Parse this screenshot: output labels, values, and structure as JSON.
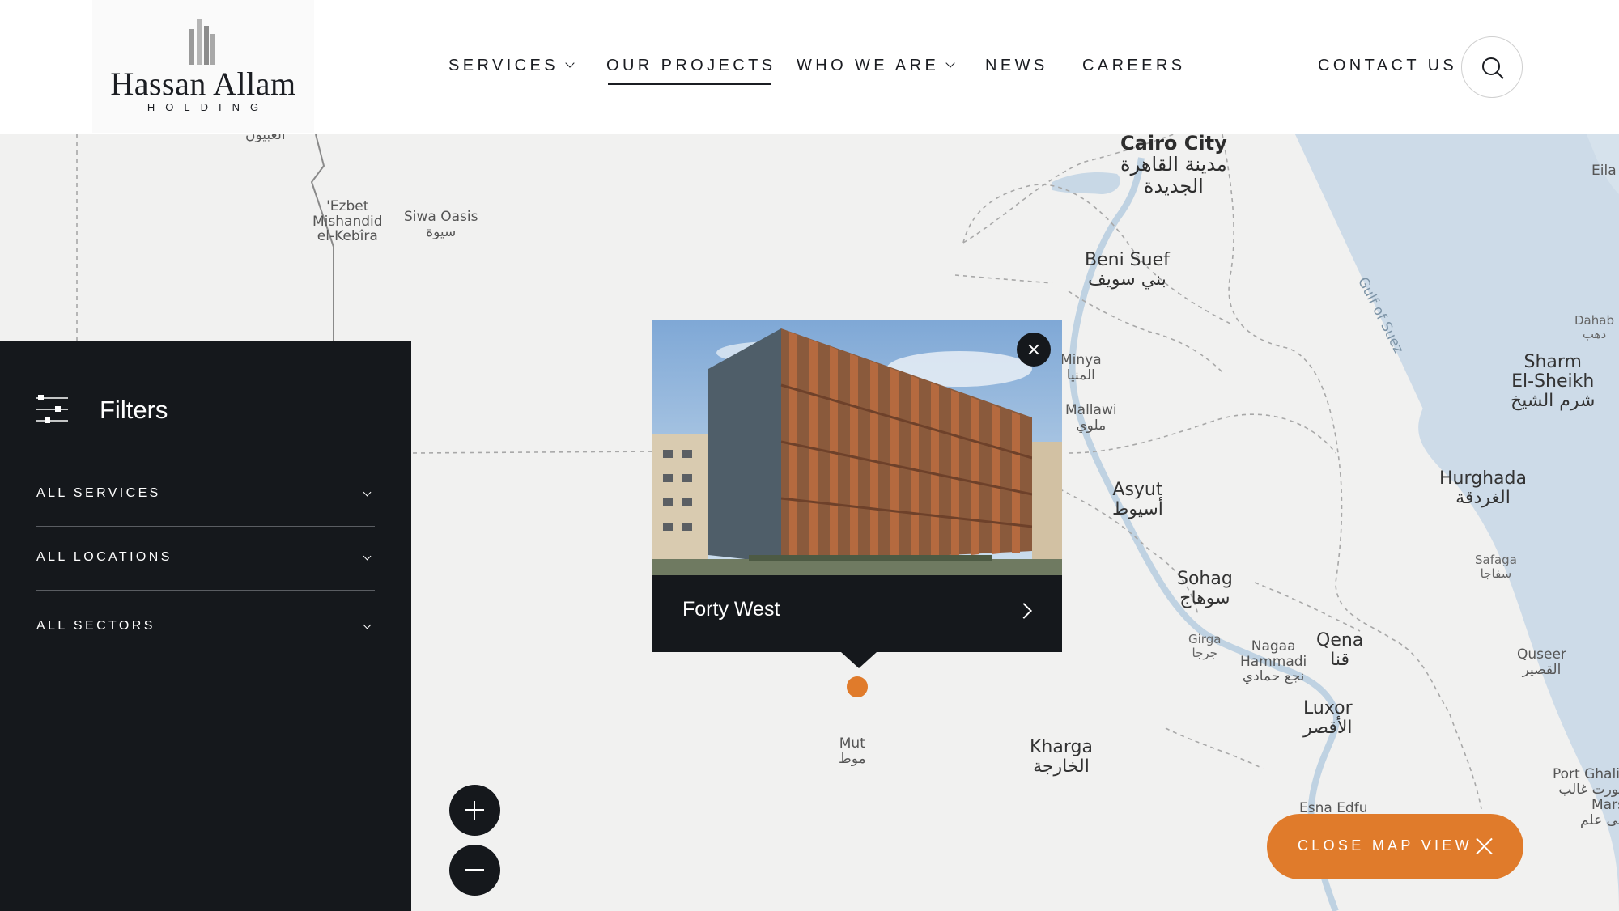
{
  "brand": {
    "name": "Hassan Allam",
    "sub": "HOLDING",
    "accent_color": "#e07b2b",
    "dark_color": "#15181c"
  },
  "nav": {
    "services": "SERVICES",
    "our_projects": "OUR PROJECTS",
    "who_we_are": "WHO WE ARE",
    "news": "NEWS",
    "careers": "CAREERS",
    "contact": "CONTACT US",
    "search_icon": "search-icon"
  },
  "filters": {
    "title": "Filters",
    "icon": "sliders-icon",
    "services": "ALL SERVICES",
    "locations": "ALL LOCATIONS",
    "sectors": "ALL SECTORS"
  },
  "popup": {
    "project_title": "Forty West",
    "close_icon": "close-icon",
    "arrow_icon": "chevron-right-icon"
  },
  "map": {
    "cairo": {
      "en": "Cairo City",
      "ar1": "مدينة القاهرة",
      "ar2": "الجديدة"
    },
    "beni_suef": {
      "en": "Beni Suef",
      "ar": "بني سويف"
    },
    "minya": {
      "en": "Minya",
      "ar": "المنيا"
    },
    "mallawi": {
      "en": "Mallawi",
      "ar": "ملوي"
    },
    "asyut": {
      "en": "Asyut",
      "ar": "أسيوط"
    },
    "sohag": {
      "en": "Sohag",
      "ar": "سوهاج"
    },
    "girga": {
      "en": "Girga",
      "ar": "جرجا"
    },
    "nagaa": {
      "en1": "Nagaa",
      "en2": "Hammadi",
      "ar": "نجع حمادي"
    },
    "qena": {
      "en": "Qena",
      "ar": "قنا"
    },
    "luxor": {
      "en": "Luxor",
      "ar": "الأقصر"
    },
    "esna_edfu": "Esna  Edfu",
    "kharga": {
      "en": "Kharga",
      "ar": "الخارجة"
    },
    "mut": {
      "en": "Mut",
      "ar": "موط"
    },
    "hurghada": {
      "en": "Hurghada",
      "ar": "الغردقة"
    },
    "safaga": {
      "en": "Safaga",
      "ar": "سفاجا"
    },
    "quseer": {
      "en": "Quseer",
      "ar": "القصير"
    },
    "sharm": {
      "en1": "Sharm",
      "en2": "El-Sheikh",
      "ar": "شرم الشيخ"
    },
    "dahab": {
      "en": "Dahab",
      "ar": "دهب"
    },
    "port_ghalib": {
      "en": "Port Ghalib",
      "ar": "بورت غالب"
    },
    "marsa": {
      "en": "Marsa",
      "ar": "مرسى علم"
    },
    "eila": "Eila",
    "gulf": "Gulf of Suez",
    "ezbet": {
      "en1": "'Ezbet",
      "en2": "Mishandid",
      "en3": "el-Kebîra"
    },
    "siwa": {
      "en": "Siwa Oasis",
      "ar": "سيوة"
    },
    "top_left_ar": "العبيون"
  },
  "zoom": {
    "in_icon": "plus-icon",
    "out_icon": "minus-icon"
  },
  "close_map": {
    "label": "CLOSE MAP VIEW",
    "icon": "close-icon"
  }
}
